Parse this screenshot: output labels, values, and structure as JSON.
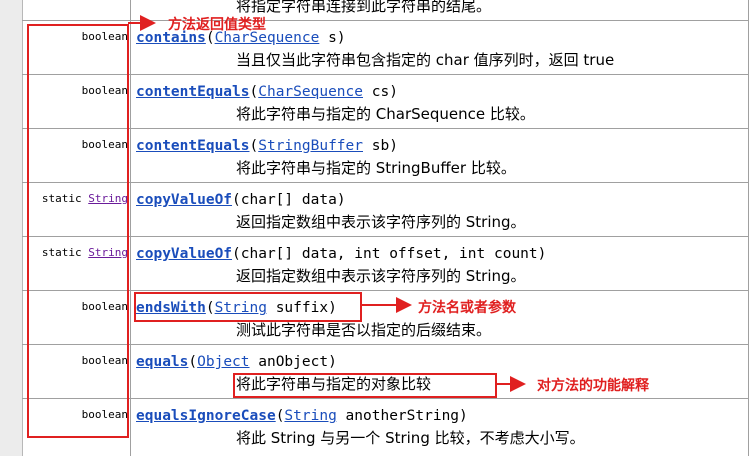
{
  "top_desc": "将指定字符串连接到此字符串的结尾。",
  "rows": [
    {
      "modifier": "",
      "type": "boolean",
      "type_link": false,
      "method": "contains",
      "params": [
        {
          "type": "CharSequence",
          "link": true,
          "name": " s"
        }
      ],
      "desc": "当且仅当此字符串包含指定的 char 值序列时，返回 true"
    },
    {
      "modifier": "",
      "type": "boolean",
      "type_link": false,
      "method": "contentEquals",
      "params": [
        {
          "type": "CharSequence",
          "link": true,
          "name": " cs"
        }
      ],
      "desc": "将此字符串与指定的 CharSequence 比较。"
    },
    {
      "modifier": "",
      "type": "boolean",
      "type_link": false,
      "method": "contentEquals",
      "params": [
        {
          "type": "StringBuffer",
          "link": true,
          "name": " sb"
        }
      ],
      "desc": "将此字符串与指定的 StringBuffer 比较。"
    },
    {
      "modifier": "static ",
      "type": "String",
      "type_link": true,
      "method": "copyValueOf",
      "params": [
        {
          "type": "char[]",
          "link": false,
          "name": " data"
        }
      ],
      "desc": "返回指定数组中表示该字符序列的 String。"
    },
    {
      "modifier": "static ",
      "type": "String",
      "type_link": true,
      "method": "copyValueOf",
      "params": [
        {
          "type": "char[]",
          "link": false,
          "name": " data, "
        },
        {
          "type": "int",
          "link": false,
          "name": " offset, "
        },
        {
          "type": "int",
          "link": false,
          "name": " count"
        }
      ],
      "desc": "返回指定数组中表示该字符序列的 String。"
    },
    {
      "modifier": "",
      "type": "boolean",
      "type_link": false,
      "method": "endsWith",
      "params": [
        {
          "type": "String",
          "link": true,
          "name": " suffix"
        }
      ],
      "desc": "测试此字符串是否以指定的后缀结束。"
    },
    {
      "modifier": "",
      "type": "boolean",
      "type_link": false,
      "method": "equals",
      "params": [
        {
          "type": "Object",
          "link": true,
          "name": " anObject"
        }
      ],
      "desc": "将此字符串与指定的对象比较"
    },
    {
      "modifier": "",
      "type": "boolean",
      "type_link": false,
      "method": "equalsIgnoreCase",
      "params": [
        {
          "type": "String",
          "link": true,
          "name": " anotherString"
        }
      ],
      "desc": "将此 String 与另一个 String 比较，不考虑大小写。"
    }
  ],
  "annotations": {
    "return_type": "方法返回值类型",
    "method_params": "方法名或者参数",
    "function_desc": "对方法的功能解释"
  },
  "colors": {
    "annotation": "#e02020",
    "link": "#1a4dbb",
    "type_link": "#6a1b9a"
  }
}
